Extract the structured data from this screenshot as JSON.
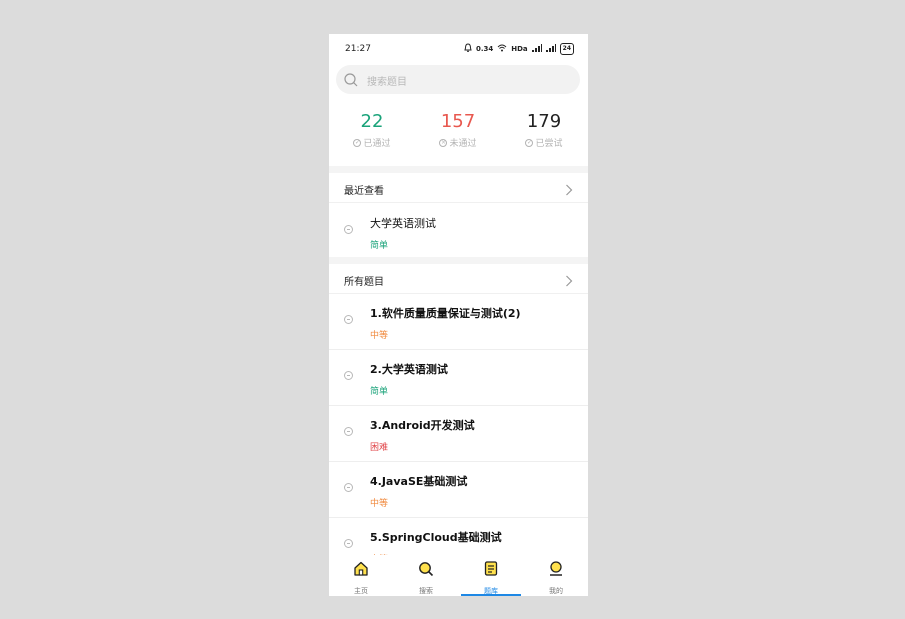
{
  "status_bar": {
    "time": "21:27",
    "icons": [
      "alarm-icon",
      "0.34 KB/s",
      "wifi-icon",
      "HD",
      "signal-icon",
      "signal-icon"
    ],
    "speed": "0.34",
    "hd": "HDa",
    "battery": "24"
  },
  "search": {
    "placeholder": "搜索题目"
  },
  "stats": [
    {
      "value": "22",
      "label": "已通过",
      "color": "#1aa37a"
    },
    {
      "value": "157",
      "label": "未通过",
      "color": "#e8584f"
    },
    {
      "value": "179",
      "label": "已尝试",
      "color": "#222222"
    }
  ],
  "recent": {
    "header": "最近查看",
    "items": [
      {
        "title": "大学英语测试",
        "difficulty": "简单",
        "color": "#1aa37a"
      }
    ]
  },
  "all": {
    "header": "所有题目",
    "items": [
      {
        "title": "1.软件质量质量保证与测试(2)",
        "difficulty": "中等",
        "color": "#f08a3e"
      },
      {
        "title": "2.大学英语测试",
        "difficulty": "简单",
        "color": "#1aa37a"
      },
      {
        "title": "3.Android开发测试",
        "difficulty": "困难",
        "color": "#e0464a"
      },
      {
        "title": "4.JavaSE基础测试",
        "difficulty": "中等",
        "color": "#f08a3e"
      },
      {
        "title": "5.SpringCloud基础测试",
        "difficulty": "中等",
        "color": "#f08a3e"
      }
    ]
  },
  "tabbar": {
    "tabs": [
      {
        "label": "主页",
        "icon": "home-icon"
      },
      {
        "label": "搜索",
        "icon": "search-icon"
      },
      {
        "label": "题库",
        "icon": "question-bank-icon",
        "active": true
      },
      {
        "label": "我的",
        "icon": "profile-icon"
      }
    ]
  }
}
